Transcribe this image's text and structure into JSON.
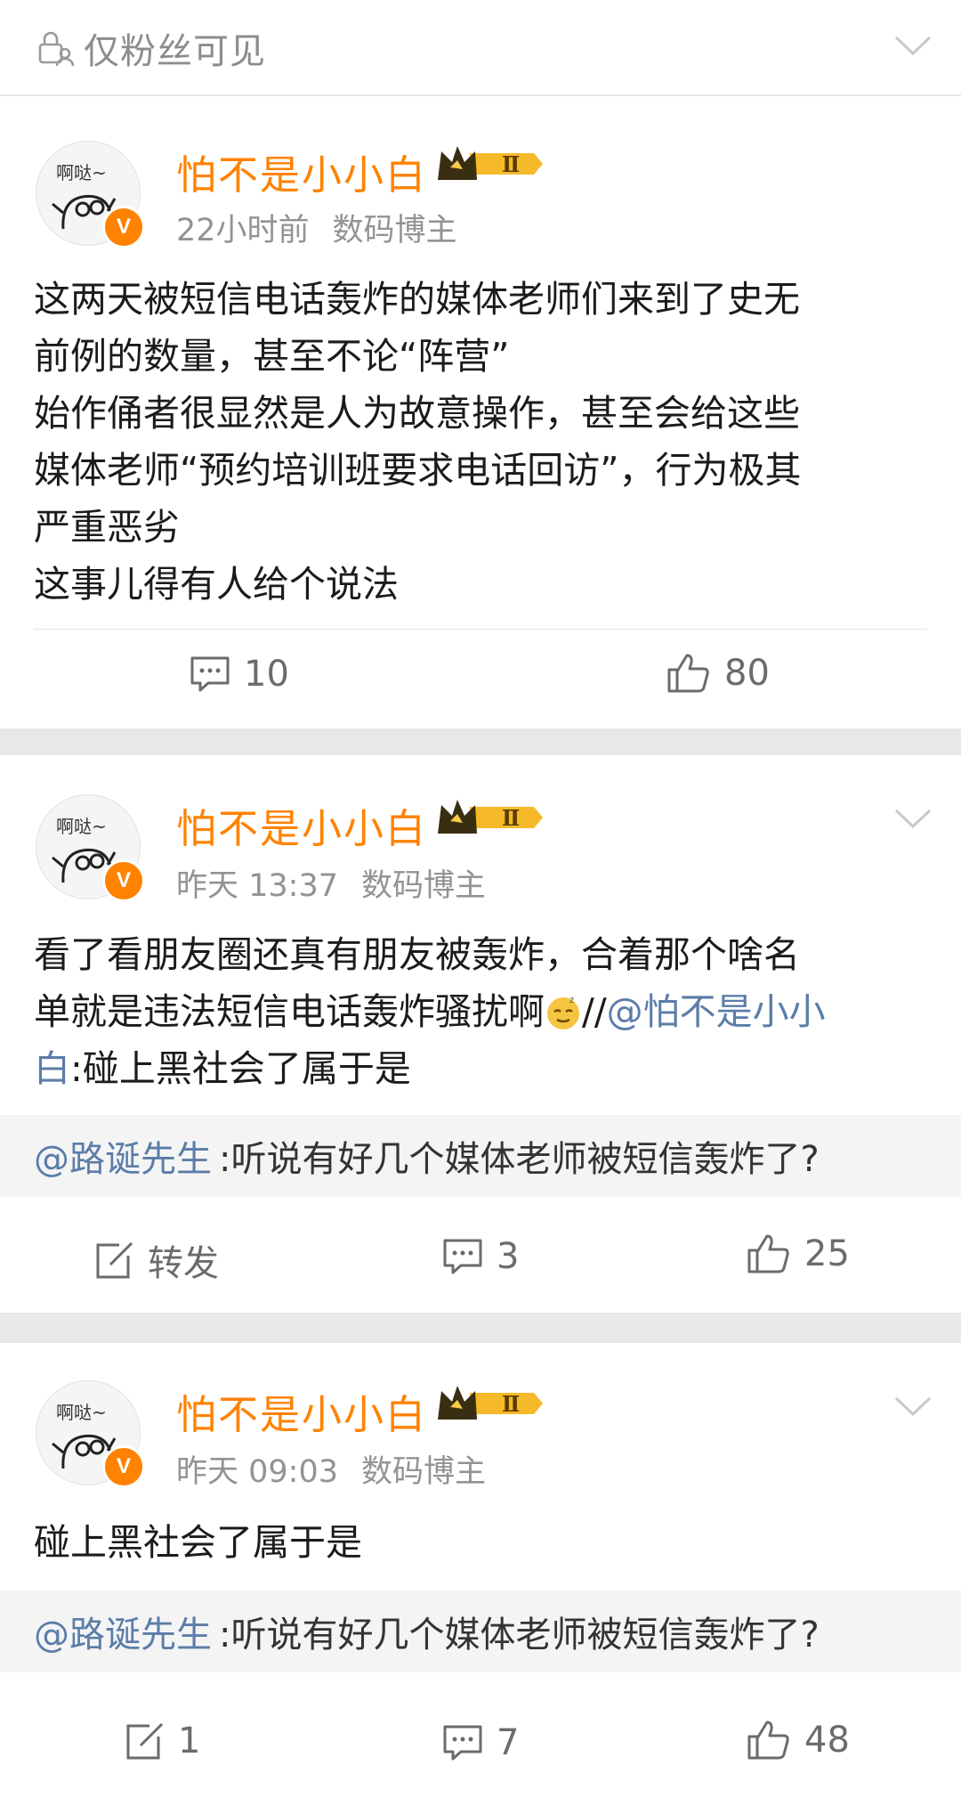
{
  "visibility": {
    "label": "仅粉丝可见",
    "icon": "lock-user-icon"
  },
  "posts": [
    {
      "avatar_text": "啊哒~",
      "username": "怕不是小小白",
      "level_badge": "Ⅱ",
      "time": "22小时前",
      "tag": "数码博主",
      "lines": [
        "这两天被短信电话轰炸的媒体老师们来到了史无",
        "前例的数量，甚至不论“阵营”",
        "始作俑者很显然是人为故意操作，甚至会给这些",
        "媒体老师“预约培训班要求电话回访”，行为极其",
        "严重恶劣",
        "这事儿得有人给个说法"
      ],
      "comments": "10",
      "likes": "80"
    },
    {
      "avatar_text": "啊哒~",
      "username": "怕不是小小白",
      "level_badge": "Ⅱ",
      "time": "昨天 13:37",
      "tag": "数码博主",
      "line1": "看了看朋友圈还真有朋友被轰炸，合着那个啥名",
      "line2_text": "单就是违法短信电话轰炸骚扰啊",
      "line2_sep": "//",
      "line2_mention": "@怕不是小小",
      "line3_mention": "白",
      "line3_text": ":碰上黑社会了属于是",
      "quote_mention": "@路诞先生",
      "quote_text": ":听说有好几个媒体老师被短信轰炸了?",
      "repost_label": "转发",
      "comments": "3",
      "likes": "25"
    },
    {
      "avatar_text": "啊哒~",
      "username": "怕不是小小白",
      "level_badge": "Ⅱ",
      "time": "昨天 09:03",
      "tag": "数码博主",
      "text": "碰上黑社会了属于是",
      "quote_mention": "@路诞先生",
      "quote_text": ":听说有好几个媒体老师被短信轰炸了?",
      "reposts": "1",
      "comments": "7",
      "likes": "48"
    }
  ],
  "colors": {
    "accent": "#ff8200",
    "link": "#5b7da8",
    "meta": "#939393"
  }
}
